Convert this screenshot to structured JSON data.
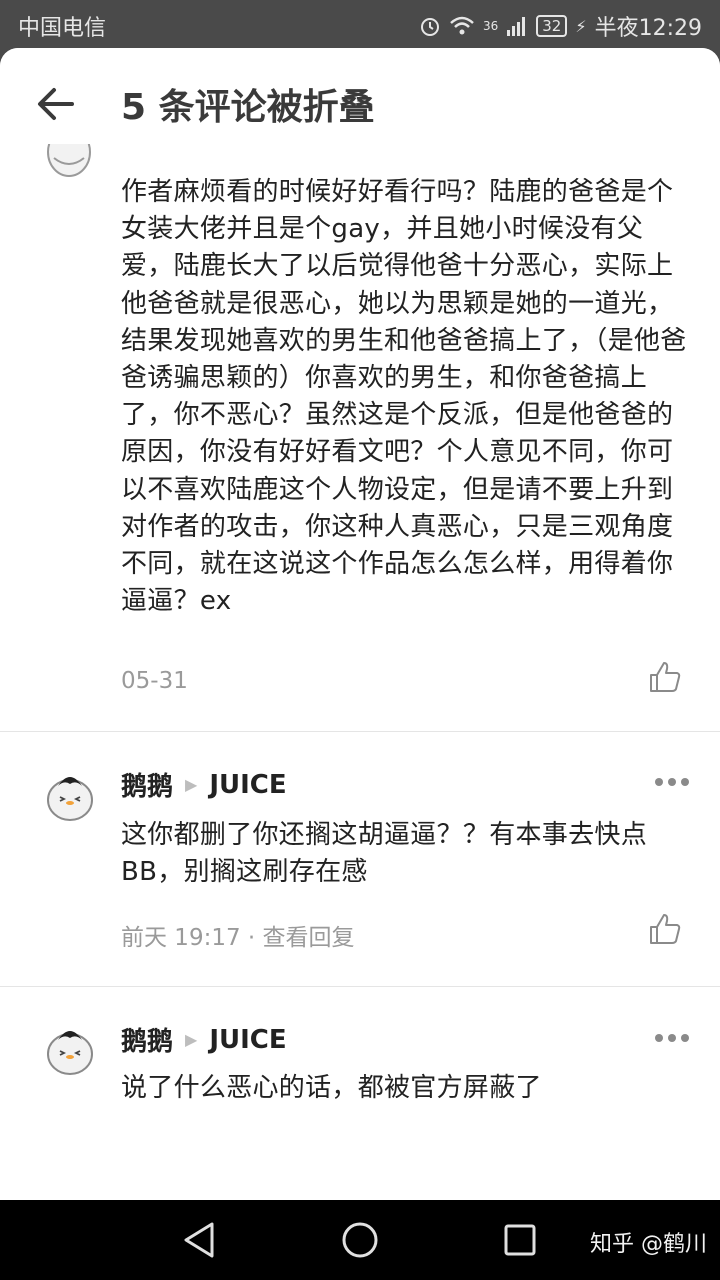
{
  "status": {
    "carrier": "中国电信",
    "network": "36",
    "battery": "32",
    "time": "半夜12:29"
  },
  "header": {
    "title": "5 条评论被折叠"
  },
  "comments": [
    {
      "text": "作者麻烦看的时候好好看行吗？陆鹿的爸爸是个女装大佬并且是个gay，并且她小时候没有父爱，陆鹿长大了以后觉得他爸十分恶心，实际上他爸爸就是很恶心，她以为思颖是她的一道光，结果发现她喜欢的男生和他爸爸搞上了，（是他爸爸诱骗思颖的）你喜欢的男生，和你爸爸搞上了，你不恶心？虽然这是个反派，但是他爸爸的原因，你没有好好看文吧？个人意见不同，你可以不喜欢陆鹿这个人物设定，但是请不要上升到对作者的攻击，你这种人真恶心，只是三观角度不同，就在这说这个作品怎么怎么样，用得着你逼逼？ex",
      "date": "05-31"
    },
    {
      "author": "鹅鹅",
      "reply_to": "JUICE",
      "text": "这你都删了你还搁这胡逼逼？？有本事去快点BB，别搁这刷存在感",
      "date": "前天 19:17",
      "separator": " · ",
      "view_replies": "查看回复"
    },
    {
      "author": "鹅鹅",
      "reply_to": "JUICE",
      "text": "说了什么恶心的话，都被官方屏蔽了"
    }
  ],
  "navbar": {
    "watermark": "知乎 @鹤川"
  }
}
